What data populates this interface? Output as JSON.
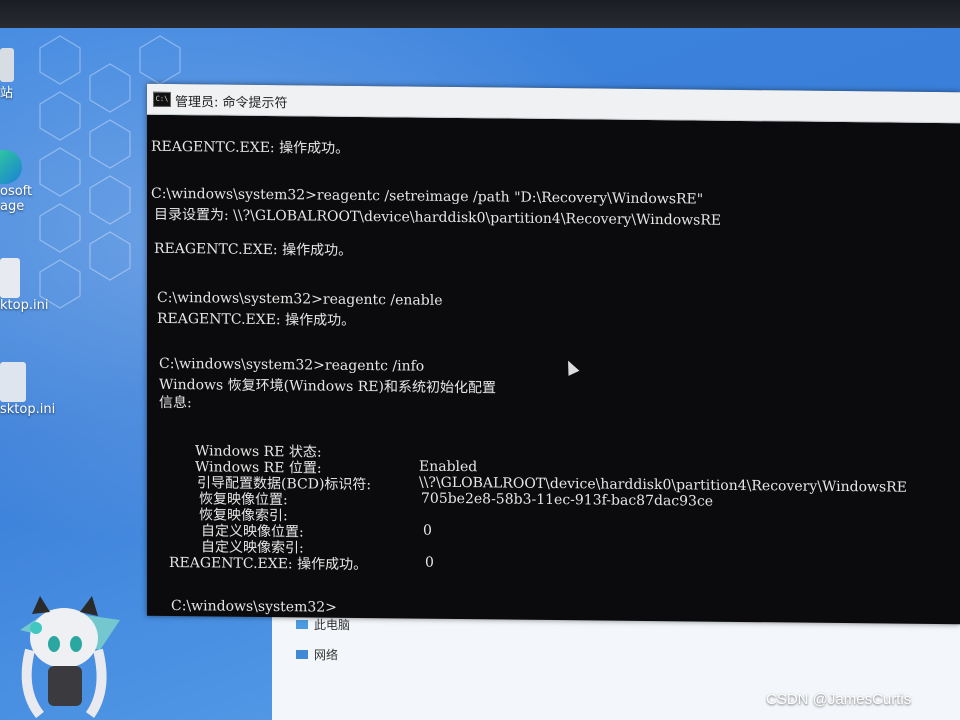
{
  "desktop": {
    "icons": [
      {
        "label": "站"
      },
      {
        "label": "osoft"
      },
      {
        "label": "age"
      },
      {
        "label": "ktop.ini"
      },
      {
        "label": "sktop.ini"
      }
    ]
  },
  "explorer": {
    "nav": [
      {
        "label": "此电脑"
      },
      {
        "label": "网络"
      }
    ]
  },
  "cmd": {
    "title": "管理员: 命令提示符",
    "icon_text": "C:\\",
    "lines": [
      "REAGENTC.EXE: 操作成功。",
      "C:\\windows\\system32>reagentc /setreimage /path \"D:\\Recovery\\WindowsRE\"",
      "目录设置为: \\\\?\\GLOBALROOT\\device\\harddisk0\\partition4\\Recovery\\WindowsRE",
      "REAGENTC.EXE: 操作成功。",
      "C:\\windows\\system32>reagentc /enable",
      "REAGENTC.EXE: 操作成功。",
      "C:\\windows\\system32>reagentc /info",
      "Windows 恢复环境(Windows RE)和系统初始化配置",
      "信息:",
      "REAGENTC.EXE: 操作成功。",
      "C:\\windows\\system32>"
    ],
    "info_table": [
      {
        "key": "Windows RE 状态:",
        "value": "Enabled"
      },
      {
        "key": "Windows RE 位置:",
        "value": "\\\\?\\GLOBALROOT\\device\\harddisk0\\partition4\\Recovery\\WindowsRE"
      },
      {
        "key": "引导配置数据(BCD)标识符:",
        "value": "705be2e8-58b3-11ec-913f-bac87dac93ce"
      },
      {
        "key": "恢复映像位置:",
        "value": ""
      },
      {
        "key": "恢复映像索引:",
        "value": "0"
      },
      {
        "key": "自定义映像位置:",
        "value": ""
      },
      {
        "key": "自定义映像索引:",
        "value": "0"
      }
    ]
  },
  "watermark": "CSDN @JamesCurtis",
  "colors": {
    "terminal_bg": "#0b0b0d",
    "terminal_text": "#e6e6e6",
    "desktop_blue": "#3a7fd9"
  }
}
